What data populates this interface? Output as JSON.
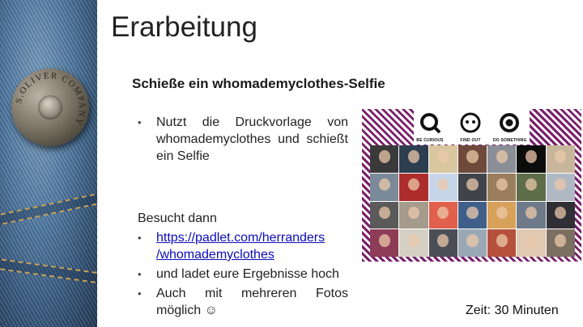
{
  "slide": {
    "title": "Erarbeitung",
    "subtitle": "Schieße ein whomademyclothes-Selfie",
    "bullets_1": [
      {
        "text": "Nutzt die Druckvorlage von whomademyclothes und schießt ein Selfie"
      }
    ],
    "followup_heading": "Besucht dann",
    "bullets_2": [
      {
        "text": "https://padlet.com/herranders/whomademyclothes",
        "line1": "https://padlet.com/herranders",
        "line2": "/whomademyclothes",
        "is_link": true
      },
      {
        "text": "und ladet eure Ergebnisse hoch"
      },
      {
        "text": "Auch mit mehreren Fotos möglich ☺"
      }
    ],
    "time_note": "Zeit: 30 Minuten"
  },
  "denim_image": {
    "button_text": "S.OLIVER COMPANY"
  },
  "collage": {
    "logos": [
      {
        "icon": "magnifier-q-icon",
        "caption": "BE CURIOUS"
      },
      {
        "icon": "face-icon",
        "caption": "FIND OUT"
      },
      {
        "icon": "target-icon",
        "caption": "DO SOMETHING"
      }
    ],
    "photo_count": 28,
    "stripe_color": "#7a1f6b"
  },
  "colors": {
    "link": "#0b0bb8",
    "text": "#222222"
  }
}
